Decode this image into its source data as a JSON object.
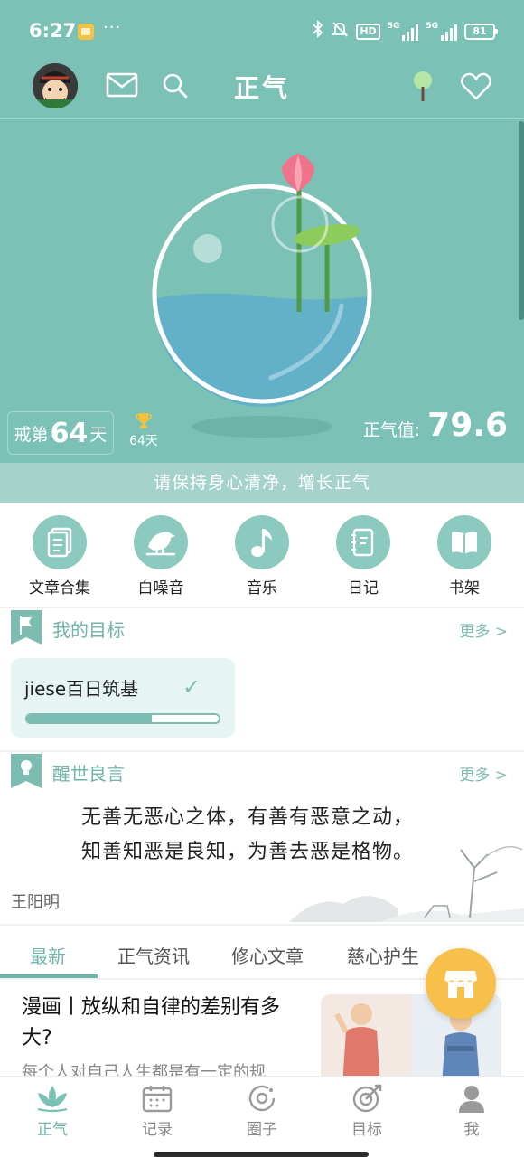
{
  "status_bar": {
    "time": "6:27",
    "dots": "···",
    "hd": "HD",
    "net1": "5G",
    "net2": "5G",
    "battery": "81"
  },
  "app_bar": {
    "title": "正气"
  },
  "hero": {
    "streak_prefix": "戒第",
    "streak_days": "64",
    "streak_suffix": "天",
    "trophy_days": "64天",
    "zq_label": "正气值:",
    "zq_value": "79.6",
    "banner": "请保持身心清净，增长正气"
  },
  "quick_entries": [
    {
      "label": "文章合集",
      "icon": "document-icon"
    },
    {
      "label": "白噪音",
      "icon": "bird-icon"
    },
    {
      "label": "音乐",
      "icon": "music-note-icon"
    },
    {
      "label": "日记",
      "icon": "notebook-icon"
    },
    {
      "label": "书架",
      "icon": "book-icon"
    }
  ],
  "goals": {
    "title": "我的目标",
    "more": "更多 >",
    "items": [
      {
        "name": "jiese百日筑基",
        "progress": 0.65
      }
    ]
  },
  "quote": {
    "title": "醒世良言",
    "more": "更多 >",
    "line1": "无善无恶心之体，有善有恶意之动，",
    "line2": "知善知恶是良知，为善去恶是格物。",
    "author": "王阳明"
  },
  "tabs": [
    {
      "label": "最新",
      "active": true
    },
    {
      "label": "正气资讯",
      "active": false
    },
    {
      "label": "修心文章",
      "active": false
    },
    {
      "label": "慈心护生",
      "active": false
    }
  ],
  "article": {
    "title": "漫画丨放纵和自律的差别有多大?",
    "summary": "每个人对自己人生都是有一定的规"
  },
  "bottom_nav": [
    {
      "label": "正气",
      "icon": "lotus-icon",
      "active": true
    },
    {
      "label": "记录",
      "icon": "calendar-icon",
      "active": false
    },
    {
      "label": "圈子",
      "icon": "circle-icon",
      "active": false
    },
    {
      "label": "目标",
      "icon": "target-icon",
      "active": false
    },
    {
      "label": "我",
      "icon": "person-icon",
      "active": false
    }
  ],
  "colors": {
    "accent": "#7cc1b6",
    "accent_dark": "#6fb4a9",
    "fab": "#f7c04a"
  }
}
